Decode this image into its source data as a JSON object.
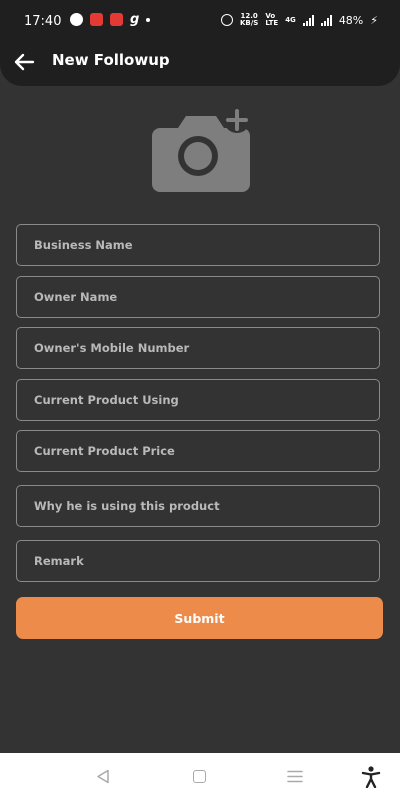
{
  "status_bar": {
    "time": "17:40",
    "network_speed_value": "12.0",
    "network_speed_unit": "KB/S",
    "volte_top": "Vo",
    "volte_bottom": "LTE",
    "network_type": "4G",
    "battery": "48%",
    "notification_icons": [
      "whatsapp-icon",
      "app-notification-icon",
      "app-notification-icon",
      "g-app-icon",
      "more-dot-icon"
    ],
    "status_icons": [
      "alarm-icon",
      "signal-icon",
      "wifi-signal-icon",
      "charging-icon"
    ]
  },
  "header": {
    "title": "New Followup",
    "back_icon": "arrow-left-icon"
  },
  "photo": {
    "icon": "add-photo-camera-icon"
  },
  "form": {
    "fields": [
      {
        "placeholder": "Business Name",
        "value": ""
      },
      {
        "placeholder": "Owner Name",
        "value": ""
      },
      {
        "placeholder": "Owner's Mobile Number",
        "value": ""
      },
      {
        "placeholder": "Current Product Using",
        "value": ""
      },
      {
        "placeholder": "Current Product Price",
        "value": ""
      },
      {
        "placeholder": "Why he is using this product",
        "value": ""
      },
      {
        "placeholder": "Remark",
        "value": ""
      }
    ],
    "submit_label": "Submit"
  },
  "nav_bar": {
    "icons": [
      "back-triangle-icon",
      "home-square-icon",
      "recents-menu-icon",
      "accessibility-icon"
    ]
  },
  "colors": {
    "background": "#333333",
    "header_background": "#1f1f1f",
    "accent": "#ec8b4a",
    "field_border": "#8a8a8a",
    "placeholder_text": "#b9b9b9"
  }
}
